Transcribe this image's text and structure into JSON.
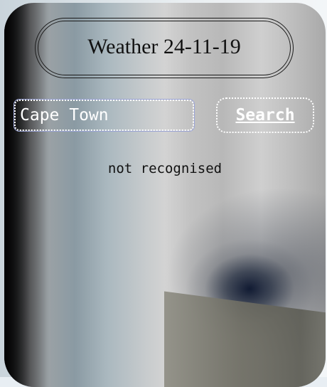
{
  "header": {
    "title": "Weather 24-11-19"
  },
  "search": {
    "value": "Cape Town",
    "button_label": "Search"
  },
  "status": {
    "message": "not recognised"
  }
}
